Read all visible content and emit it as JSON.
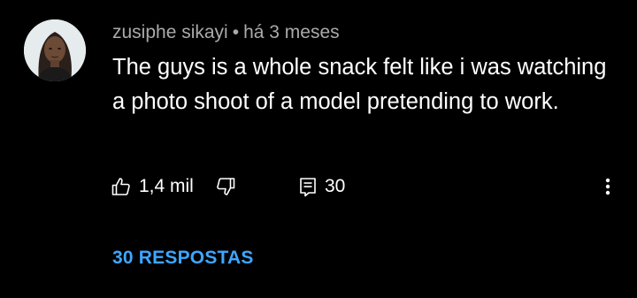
{
  "comment": {
    "author": "zusiphe sikayi",
    "separator": "•",
    "time": "há 3 meses",
    "text": "The guys is a whole snack felt like i was watching a photo shoot of a model pretending to work.",
    "likes": "1,4 mil",
    "reply_count": "30",
    "replies_link": "30 RESPOSTAS"
  },
  "icons": {
    "like": "thumbs-up-icon",
    "dislike": "thumbs-down-icon",
    "reply": "reply-comment-icon",
    "menu": "more-vertical-icon"
  },
  "colors": {
    "background": "#000000",
    "text": "#ffffff",
    "secondary_text": "#aaaaaa",
    "link": "#3ea6ff"
  }
}
